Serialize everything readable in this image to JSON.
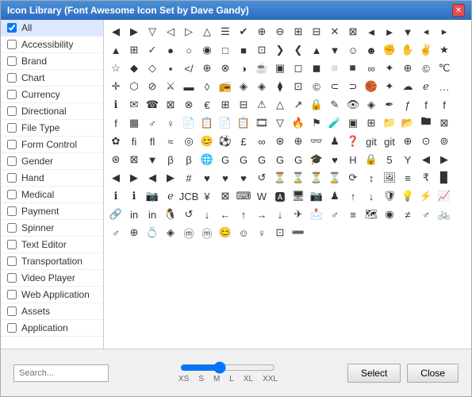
{
  "dialog": {
    "title": "Icon Library (Font Awesome Icon Set by Dave Gandy)",
    "close_label": "✕"
  },
  "sidebar": {
    "items": [
      {
        "id": "all",
        "label": "All",
        "checked": true
      },
      {
        "id": "accessibility",
        "label": "Accessibility",
        "checked": false
      },
      {
        "id": "brand",
        "label": "Brand",
        "checked": false
      },
      {
        "id": "chart",
        "label": "Chart",
        "checked": false
      },
      {
        "id": "currency",
        "label": "Currency",
        "checked": false
      },
      {
        "id": "directional",
        "label": "Directional",
        "checked": false
      },
      {
        "id": "file-type",
        "label": "File Type",
        "checked": false
      },
      {
        "id": "form-control",
        "label": "Form Control",
        "checked": false
      },
      {
        "id": "gender",
        "label": "Gender",
        "checked": false
      },
      {
        "id": "hand",
        "label": "Hand",
        "checked": false
      },
      {
        "id": "medical",
        "label": "Medical",
        "checked": false
      },
      {
        "id": "payment",
        "label": "Payment",
        "checked": false
      },
      {
        "id": "spinner",
        "label": "Spinner",
        "checked": false
      },
      {
        "id": "text-editor",
        "label": "Text Editor",
        "checked": false
      },
      {
        "id": "transportation",
        "label": "Transportation",
        "checked": false
      },
      {
        "id": "video-player",
        "label": "Video Player",
        "checked": false
      },
      {
        "id": "web-application",
        "label": "Web Application",
        "checked": false
      },
      {
        "id": "assets",
        "label": "Assets",
        "checked": false
      },
      {
        "id": "application",
        "label": "Application",
        "checked": false
      }
    ]
  },
  "icons": [
    "◀",
    "▶",
    "▽",
    "◁",
    "▷",
    "△",
    "☰",
    "✔",
    "⊕",
    "⊖",
    "⊞",
    "⊟",
    "✕",
    "⊠",
    "◄",
    "►",
    "▼",
    "◂",
    "▸",
    "▲",
    "⊞",
    "✓",
    "●",
    "○",
    "◉",
    "□",
    "■",
    "⊡",
    "❯",
    "❮",
    "▲",
    "▼",
    "☺",
    "☻",
    "✊",
    "✋",
    "✌",
    "★",
    "☆",
    "◆",
    "◇",
    "▪",
    "</",
    "⊕",
    "⊗",
    "◑",
    "☕",
    "▣",
    "◻",
    "◼",
    "◽",
    "◾",
    "∞",
    "✦",
    "⊕",
    "©",
    "℃",
    "✛",
    "⬡",
    "⊘",
    "⚔",
    "▬",
    "◊",
    "📻",
    "◈",
    "◈",
    "⧫",
    "⊡",
    "©",
    "⊂",
    "⊃",
    "🏀",
    "✦",
    "☁",
    "ℯ",
    "…",
    "ℹ",
    "✉",
    "☎",
    "⊠",
    "⊗",
    "€",
    "⊞",
    "⊟",
    "⚠",
    "△",
    "↗",
    "🔒",
    "✎",
    "👁",
    "◈",
    "✒",
    "ƒ",
    "f",
    "f",
    "f",
    "▦",
    "♂",
    "♀",
    "📄",
    "📋",
    "📄",
    "📋",
    "🎞",
    "▽",
    "🔥",
    "⚑",
    "🧪",
    "▣",
    "⊞",
    "📁",
    "📂",
    "🖿",
    "⊠",
    "✿",
    "fi",
    "fl",
    "≈",
    "◎",
    "😊",
    "⚽",
    "£",
    "∞",
    "⊛",
    "⊕",
    "👓",
    "♟",
    "❓",
    "git",
    "git",
    "⊕",
    "⊙",
    "⊚",
    "⊛",
    "⊠",
    "▼",
    "β",
    "β",
    "🌐",
    "G",
    "G",
    "G",
    "G",
    "G",
    "🎓",
    "♥",
    "H",
    "🔒",
    "5",
    "Y",
    "◀",
    "▶",
    "◀",
    "▶",
    "◀",
    "▶",
    "#",
    "♥",
    "♥",
    "♥",
    "↺",
    "⏳",
    "⌛",
    "⏳",
    "⌛",
    "⟳",
    "↕",
    "🖼",
    "≡",
    "₹",
    "▉",
    "ℹ",
    "ℹ",
    "📷",
    "ℯ",
    "JCB",
    "¥",
    "⊠",
    "⌨",
    "W",
    "🅰",
    "🖥",
    "📷",
    "♟",
    "↑",
    "↓",
    "🛡",
    "💡",
    "⚡",
    "📈",
    "🔗",
    "in",
    "in",
    "🐧",
    "↺",
    "↓",
    "←",
    "↑",
    "→",
    "↓",
    "✈",
    "📩",
    "♂",
    "≡",
    "🗺",
    "◉",
    "≠",
    "♂",
    "🚲",
    "♂",
    "⊕",
    "💍",
    "◈",
    "ⓜ",
    "ⓜ",
    "😊",
    "☺",
    "♀",
    "⊡",
    "➖"
  ],
  "bottom": {
    "search_placeholder": "Search...",
    "size_labels": [
      "XS",
      "S",
      "M",
      "L",
      "XL",
      "XXL"
    ],
    "select_label": "Select",
    "close_label": "Close"
  }
}
